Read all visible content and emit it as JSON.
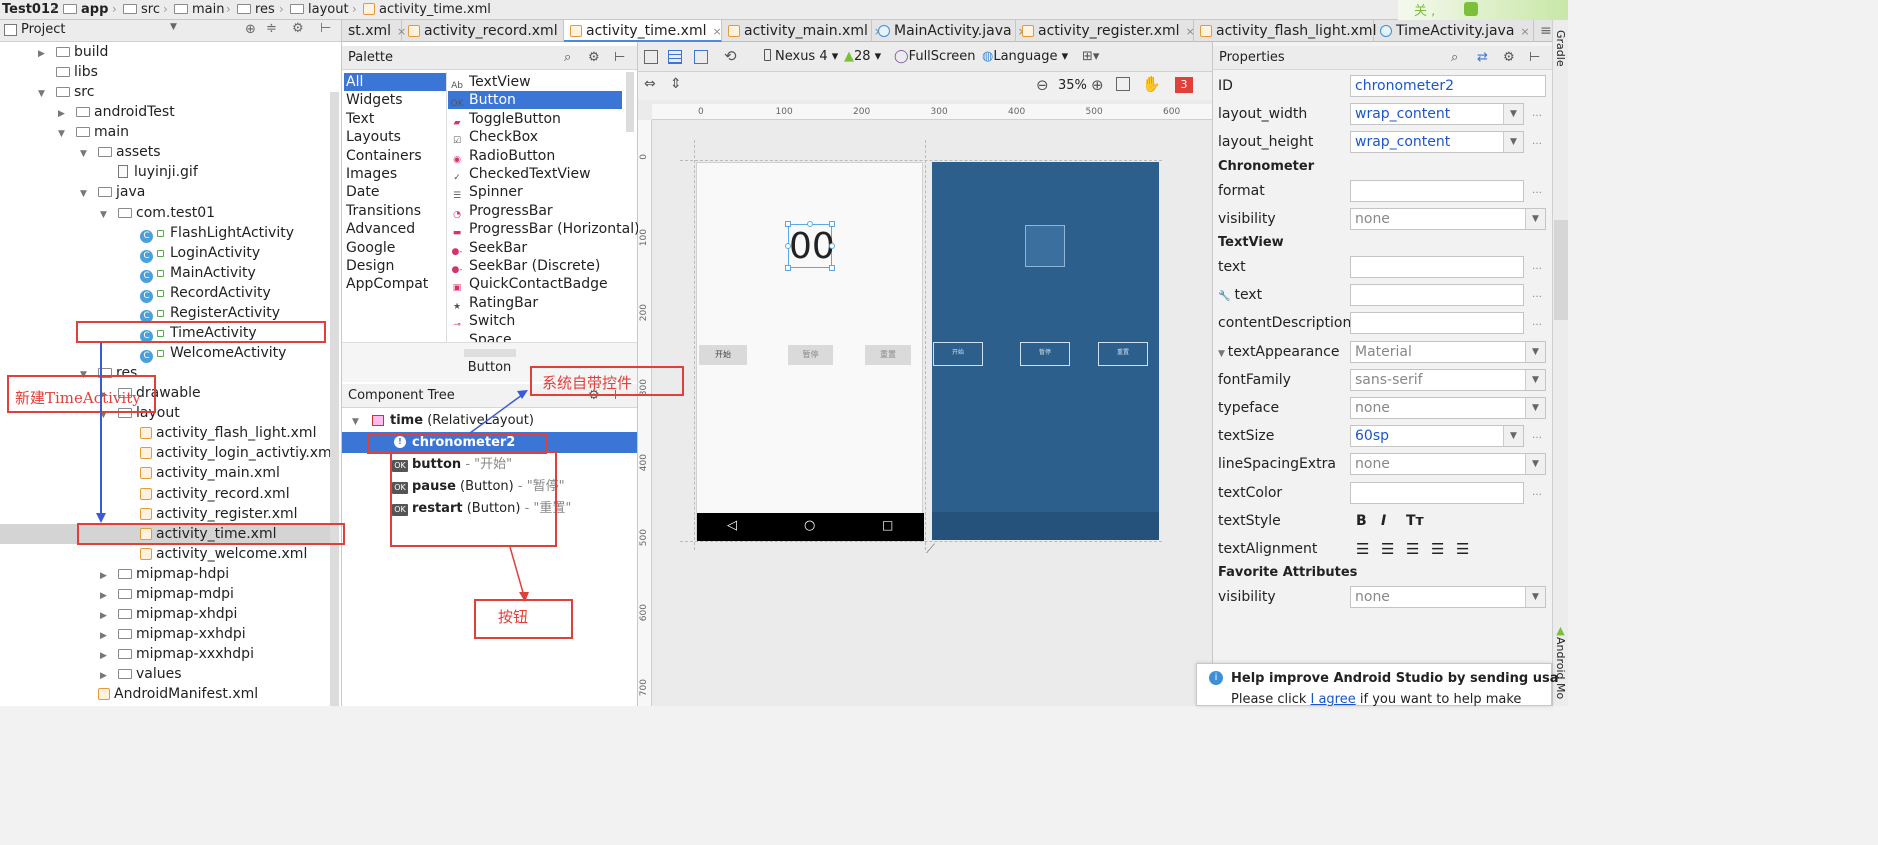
{
  "breadcrumb": {
    "items": [
      "Test012",
      "app",
      "src",
      "main",
      "res",
      "layout",
      "activity_time.xml"
    ]
  },
  "tabs": [
    {
      "label": "st.xml",
      "type": "xml"
    },
    {
      "label": "activity_record.xml",
      "type": "xml"
    },
    {
      "label": "activity_time.xml",
      "type": "xml",
      "active": true
    },
    {
      "label": "activity_main.xml",
      "type": "xml"
    },
    {
      "label": "MainActivity.java",
      "type": "java"
    },
    {
      "label": "activity_register.xml",
      "type": "xml"
    },
    {
      "label": "activity_flash_light.xml",
      "type": "xml"
    },
    {
      "label": "TimeActivity.java",
      "type": "java"
    }
  ],
  "tabs_overflow": "≡₁",
  "project": {
    "header": "Project",
    "tree": [
      {
        "label": "build",
        "indent": 1,
        "arrow": "right",
        "icon": "folder"
      },
      {
        "label": "libs",
        "indent": 1,
        "arrow": "",
        "icon": "folder"
      },
      {
        "label": "src",
        "indent": 1,
        "arrow": "down",
        "icon": "folder"
      },
      {
        "label": "androidTest",
        "indent": 2,
        "arrow": "right",
        "icon": "folder"
      },
      {
        "label": "main",
        "indent": 2,
        "arrow": "down",
        "icon": "folder"
      },
      {
        "label": "assets",
        "indent": 3,
        "arrow": "down",
        "icon": "folder"
      },
      {
        "label": "luyinji.gif",
        "indent": 4,
        "arrow": "",
        "icon": "gif"
      },
      {
        "label": "java",
        "indent": 3,
        "arrow": "down",
        "icon": "folder"
      },
      {
        "label": "com.test01",
        "indent": 4,
        "arrow": "down",
        "icon": "folder"
      },
      {
        "label": "FlashLightActivity",
        "indent": 5,
        "arrow": "",
        "icon": "class"
      },
      {
        "label": "LoginActivity",
        "indent": 5,
        "arrow": "",
        "icon": "class"
      },
      {
        "label": "MainActivity",
        "indent": 5,
        "arrow": "",
        "icon": "class"
      },
      {
        "label": "RecordActivity",
        "indent": 5,
        "arrow": "",
        "icon": "class"
      },
      {
        "label": "RegisterActivity",
        "indent": 5,
        "arrow": "",
        "icon": "class"
      },
      {
        "label": "TimeActivity",
        "indent": 5,
        "arrow": "",
        "icon": "class"
      },
      {
        "label": "WelcomeActivity",
        "indent": 5,
        "arrow": "",
        "icon": "class"
      },
      {
        "label": "res",
        "indent": 3,
        "arrow": "down",
        "icon": "folder"
      },
      {
        "label": "drawable",
        "indent": 4,
        "arrow": "right",
        "icon": "folder"
      },
      {
        "label": "layout",
        "indent": 4,
        "arrow": "down",
        "icon": "folder"
      },
      {
        "label": "activity_flash_light.xml",
        "indent": 5,
        "arrow": "",
        "icon": "xml"
      },
      {
        "label": "activity_login_activtiy.xml",
        "indent": 5,
        "arrow": "",
        "icon": "xml"
      },
      {
        "label": "activity_main.xml",
        "indent": 5,
        "arrow": "",
        "icon": "xml"
      },
      {
        "label": "activity_record.xml",
        "indent": 5,
        "arrow": "",
        "icon": "xml"
      },
      {
        "label": "activity_register.xml",
        "indent": 5,
        "arrow": "",
        "icon": "xml"
      },
      {
        "label": "activity_time.xml",
        "indent": 5,
        "arrow": "",
        "icon": "xml",
        "selected": true
      },
      {
        "label": "activity_welcome.xml",
        "indent": 5,
        "arrow": "",
        "icon": "xml"
      },
      {
        "label": "mipmap-hdpi",
        "indent": 4,
        "arrow": "right",
        "icon": "folder"
      },
      {
        "label": "mipmap-mdpi",
        "indent": 4,
        "arrow": "right",
        "icon": "folder"
      },
      {
        "label": "mipmap-xhdpi",
        "indent": 4,
        "arrow": "right",
        "icon": "folder"
      },
      {
        "label": "mipmap-xxhdpi",
        "indent": 4,
        "arrow": "right",
        "icon": "folder"
      },
      {
        "label": "mipmap-xxxhdpi",
        "indent": 4,
        "arrow": "right",
        "icon": "folder"
      },
      {
        "label": "values",
        "indent": 4,
        "arrow": "right",
        "icon": "folder"
      },
      {
        "label": "AndroidManifest.xml",
        "indent": 3,
        "arrow": "",
        "icon": "xml"
      }
    ]
  },
  "palette": {
    "title": "Palette",
    "categories": [
      "All",
      "Widgets",
      "Text",
      "Layouts",
      "Containers",
      "Images",
      "Date",
      "Transitions",
      "Advanced",
      "Google",
      "Design",
      "AppCompat"
    ],
    "selected_category": "All",
    "widgets": [
      "TextView",
      "Button",
      "ToggleButton",
      "CheckBox",
      "RadioButton",
      "CheckedTextView",
      "Spinner",
      "ProgressBar",
      "ProgressBar (Horizontal)",
      "SeekBar",
      "SeekBar (Discrete)",
      "QuickContactBadge",
      "RatingBar",
      "Switch",
      "Space"
    ],
    "selected_widget": "Button",
    "preview_label": "Button"
  },
  "component_tree": {
    "title": "Component Tree",
    "root": {
      "id": "time",
      "type": "(RelativeLayout)"
    },
    "children": [
      {
        "id": "chronometer2",
        "type": "",
        "text": "",
        "selected": true
      },
      {
        "id": "button",
        "type": "",
        "text": "- \"开始\""
      },
      {
        "id": "pause",
        "type": "(Button)",
        "text": "- \"暂停\""
      },
      {
        "id": "restart",
        "type": "(Button)",
        "text": "- \"重置\""
      }
    ]
  },
  "design_toolbar": {
    "device": "Nexus 4",
    "api": "28",
    "theme": "FullScreen",
    "language": "Language",
    "zoom": "35%",
    "warnings": "3"
  },
  "ruler": {
    "top": [
      "0",
      "100",
      "200",
      "300",
      "400",
      "500",
      "600"
    ],
    "left": [
      "0",
      "100",
      "200",
      "300",
      "400",
      "500",
      "600",
      "700"
    ]
  },
  "preview": {
    "chronometer_text": "00",
    "buttons": [
      "开始",
      "暂停",
      "重置"
    ]
  },
  "properties": {
    "title": "Properties",
    "rows": [
      {
        "kind": "field",
        "label": "ID",
        "value": "chronometer2",
        "dropdown": false
      },
      {
        "kind": "field",
        "label": "layout_width",
        "value": "wrap_content",
        "dropdown": true
      },
      {
        "kind": "field",
        "label": "layout_height",
        "value": "wrap_content",
        "dropdown": true
      },
      {
        "kind": "section",
        "label": "Chronometer"
      },
      {
        "kind": "field",
        "label": "format",
        "value": "",
        "dropdown": false
      },
      {
        "kind": "field",
        "label": "visibility",
        "value": "none",
        "dropdown": true,
        "gray": true
      },
      {
        "kind": "section",
        "label": "TextView"
      },
      {
        "kind": "field",
        "label": "text",
        "value": "",
        "dropdown": false
      },
      {
        "kind": "field",
        "label": "text",
        "value": "",
        "dropdown": false,
        "wrench": true
      },
      {
        "kind": "field",
        "label": "contentDescription",
        "value": "",
        "dropdown": false
      },
      {
        "kind": "field",
        "label": "textAppearance",
        "value": "Material",
        "dropdown": true,
        "gray": true,
        "expander": true
      },
      {
        "kind": "field",
        "label": "fontFamily",
        "value": "sans-serif",
        "dropdown": true,
        "gray": true
      },
      {
        "kind": "field",
        "label": "typeface",
        "value": "none",
        "dropdown": true,
        "gray": true
      },
      {
        "kind": "field",
        "label": "textSize",
        "value": "60sp",
        "dropdown": true
      },
      {
        "kind": "field",
        "label": "lineSpacingExtra",
        "value": "none",
        "dropdown": true,
        "gray": true
      },
      {
        "kind": "field",
        "label": "textColor",
        "value": "",
        "dropdown": false
      },
      {
        "kind": "style",
        "label": "textStyle"
      },
      {
        "kind": "align",
        "label": "textAlignment"
      },
      {
        "kind": "section",
        "label": "Favorite Attributes"
      },
      {
        "kind": "field",
        "label": "visibility",
        "value": "none",
        "dropdown": true,
        "gray": true
      }
    ]
  },
  "right_strip": {
    "gradle": "Gradle",
    "android_model": "Android Mo"
  },
  "annotations": {
    "new_activity": "新建TimeActivity",
    "system_widget": "系统自带控件",
    "buttons": "按钮",
    "corner": "关  ,"
  },
  "notification": {
    "title": "Help improve Android Studio by sending usa",
    "line_prefix": "Please click ",
    "link": "I agree",
    "line_suffix": " if you want to help make"
  },
  "colors": {
    "selection": "#3b75d6",
    "annotation_red": "#e0403a",
    "blueprint": "#2d5f8c",
    "value_blue": "#1a56c9"
  }
}
